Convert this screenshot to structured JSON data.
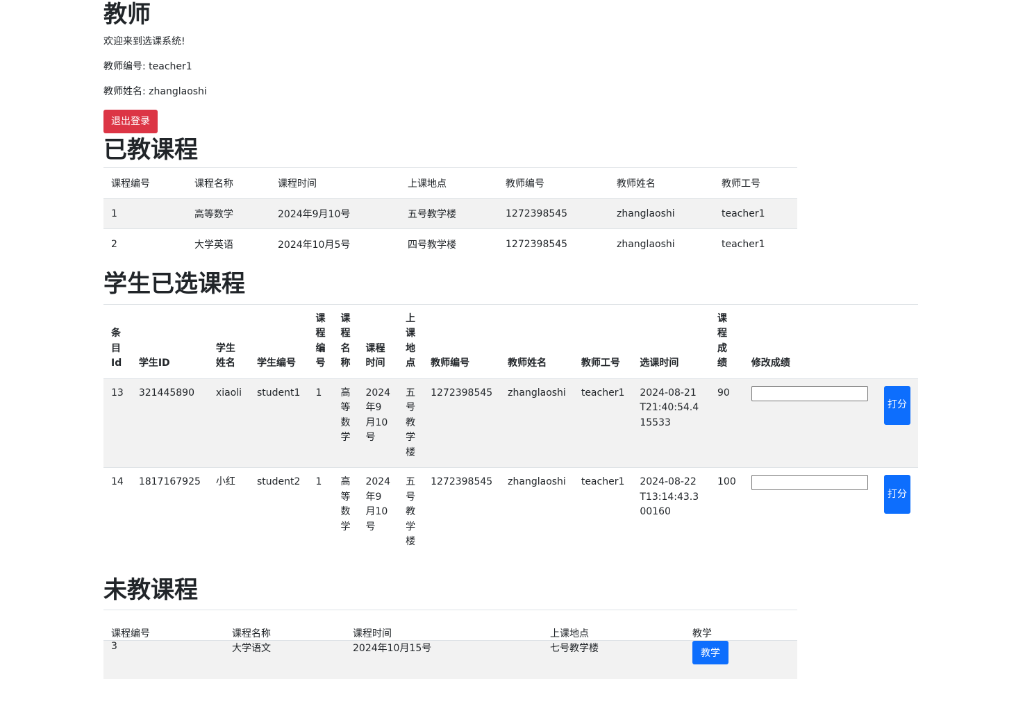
{
  "header": {
    "title": "教师",
    "welcome": "欢迎来到选课系统!",
    "teacher_no": "教师编号: teacher1",
    "teacher_name": "教师姓名: zhanglaoshi",
    "logout": "退出登录"
  },
  "taught": {
    "title": "已教课程",
    "columns": [
      "课程编号",
      "课程名称",
      "课程时间",
      "上课地点",
      "教师编号",
      "教师姓名",
      "教师工号"
    ],
    "rows": [
      [
        "1",
        "高等数学",
        "2024年9月10号",
        "五号教学楼",
        "1272398545",
        "zhanglaoshi",
        "teacher1"
      ],
      [
        "2",
        "大学英语",
        "2024年10月5号",
        "四号教学楼",
        "1272398545",
        "zhanglaoshi",
        "teacher1"
      ]
    ]
  },
  "selected": {
    "title": "学生已选课程",
    "columns": [
      "条目Id",
      "学生ID",
      "学生姓名",
      "学生编号",
      "课程编号",
      "课程名称",
      "课程时间",
      "上课地点",
      "教师编号",
      "教师姓名",
      "教师工号",
      "选课时间",
      "课程成绩",
      "修改成绩"
    ],
    "rows": [
      [
        "13",
        "321445890",
        "xiaoli",
        "student1",
        "1",
        "高等数学",
        "2024年9月10号",
        "五号教学楼",
        "1272398545",
        "zhanglaoshi",
        "teacher1",
        "2024-08-21T21:40:54.415533",
        "90"
      ],
      [
        "14",
        "1817167925",
        "小红",
        "student2",
        "1",
        "高等数学",
        "2024年9月10号",
        "五号教学楼",
        "1272398545",
        "zhanglaoshi",
        "teacher1",
        "2024-08-22T13:14:43.300160",
        "100"
      ]
    ],
    "score_button": "打分",
    "grade_inputs": [
      "",
      ""
    ]
  },
  "untaught": {
    "title": "未教课程",
    "columns": [
      "课程编号",
      "课程名称",
      "课程时间",
      "上课地点",
      "教学"
    ],
    "rows": [
      [
        "3",
        "大学语文",
        "2024年10月15号",
        "七号教学楼"
      ]
    ],
    "teach_button": "教学"
  },
  "colors": {
    "danger": "#dc3545",
    "primary": "#0d6efd",
    "stripe": "#f2f2f2",
    "border": "#dee2e6"
  }
}
